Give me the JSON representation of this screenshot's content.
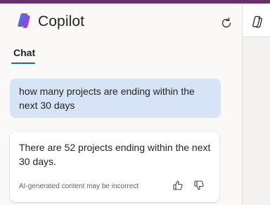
{
  "header": {
    "title": "Copilot",
    "logo_icon": "copilot-logo-icon",
    "refresh_icon": "refresh-icon"
  },
  "tabs": [
    {
      "label": "Chat",
      "active": true
    }
  ],
  "conversation": {
    "user_message": "how many projects are ending within the next 30 days",
    "assistant_message": "There are 52 projects ending within the next 30 days.",
    "disclaimer": "AI-generated content may be incorrect",
    "feedback_icons": [
      "thumbs-up-icon",
      "thumbs-down-icon"
    ]
  },
  "side_strip": {
    "icon": "copilot-app-icon"
  },
  "colors": {
    "top_bar": "#6b2f70",
    "accent": "#0f6cbd",
    "user_bubble": "#d7e4f7"
  }
}
